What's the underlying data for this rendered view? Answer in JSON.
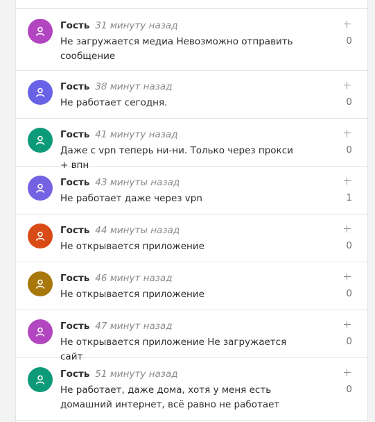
{
  "comments": [
    {
      "author": "Гость",
      "time": "31 минуту назад",
      "text": "Не загружается медиа Невозможно отправить сообщение",
      "count": "0",
      "avatar_color": "#b245c0"
    },
    {
      "author": "Гость",
      "time": "38 минут назад",
      "text": "Не работает сегодня.",
      "count": "0",
      "avatar_color": "#6a62e6"
    },
    {
      "author": "Гость",
      "time": "41 минуту назад",
      "text": "Даже с vpn теперь ни-ни. Только через прокси + впн",
      "count": "0",
      "avatar_color": "#0d9a78"
    },
    {
      "author": "Гость",
      "time": "43 минуты назад",
      "text": "Не работает даже через vpn",
      "count": "1",
      "avatar_color": "#7562e3"
    },
    {
      "author": "Гость",
      "time": "44 минуты назад",
      "text": "Не открывается приложение",
      "count": "0",
      "avatar_color": "#d94b16"
    },
    {
      "author": "Гость",
      "time": "46 минут назад",
      "text": "Не открывается приложение",
      "count": "0",
      "avatar_color": "#a8780c"
    },
    {
      "author": "Гость",
      "time": "47 минут назад",
      "text": "Не открывается приложение Не загружается сайт",
      "count": "0",
      "avatar_color": "#b245c0"
    },
    {
      "author": "Гость",
      "time": "51 минуту назад",
      "text": "Не работает, даже дома, хотя у меня есть домашний интернет, всё равно не работает",
      "count": "0",
      "avatar_color": "#0d9a78"
    }
  ]
}
